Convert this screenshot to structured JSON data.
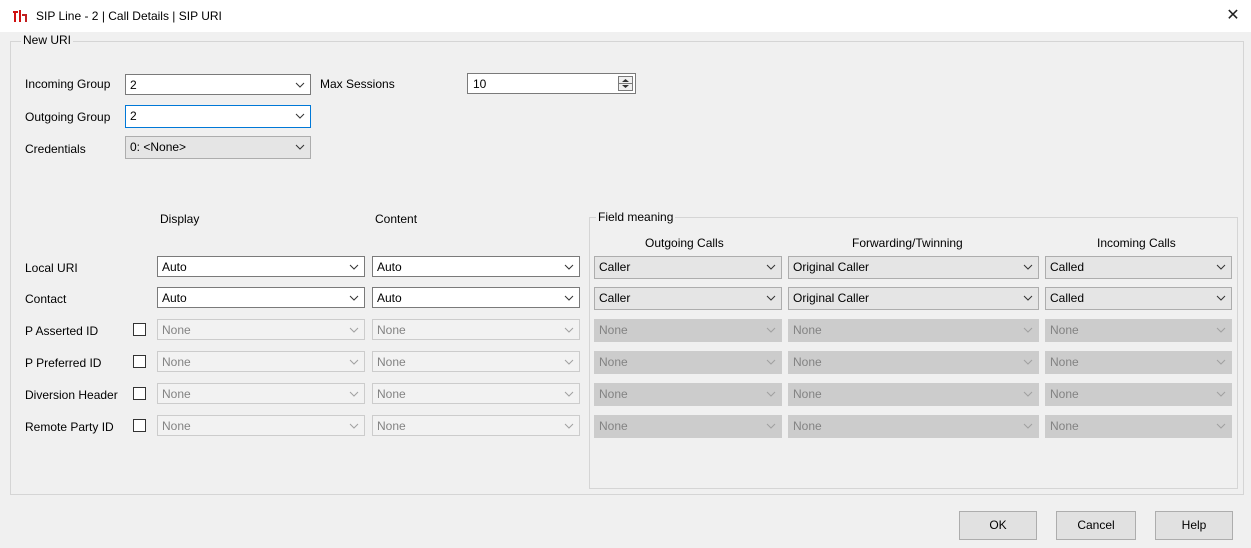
{
  "window": {
    "title": "SIP Line - 2 | Call Details | SIP URI",
    "close_glyph": "✕"
  },
  "new_uri": {
    "group_label": "New URI"
  },
  "incoming_group": {
    "label": "Incoming Group",
    "value": "2"
  },
  "outgoing_group": {
    "label": "Outgoing Group",
    "value": "2"
  },
  "credentials": {
    "label": "Credentials",
    "value": "0: <None>"
  },
  "max_sessions": {
    "label": "Max Sessions",
    "value": "10"
  },
  "headers": {
    "display": "Display",
    "content": "Content"
  },
  "field_meaning": {
    "label": "Field meaning",
    "outgoing": "Outgoing Calls",
    "forwarding": "Forwarding/Twinning",
    "incoming": "Incoming Calls"
  },
  "rows": [
    {
      "label": "Local URI",
      "display": "Auto",
      "content": "Auto",
      "outgoing": "Caller",
      "forwarding": "Original Caller",
      "incoming": "Called"
    },
    {
      "label": "Contact",
      "display": "Auto",
      "content": "Auto",
      "outgoing": "Caller",
      "forwarding": "Original Caller",
      "incoming": "Called"
    },
    {
      "label": "P Asserted ID",
      "display": "None",
      "content": "None",
      "outgoing": "None",
      "forwarding": "None",
      "incoming": "None",
      "checked": false
    },
    {
      "label": "P Preferred  ID",
      "display": "None",
      "content": "None",
      "outgoing": "None",
      "forwarding": "None",
      "incoming": "None",
      "checked": false
    },
    {
      "label": "Diversion Header",
      "display": "None",
      "content": "None",
      "outgoing": "None",
      "forwarding": "None",
      "incoming": "None",
      "checked": false
    },
    {
      "label": "Remote Party ID",
      "display": "None",
      "content": "None",
      "outgoing": "None",
      "forwarding": "None",
      "incoming": "None",
      "checked": false
    }
  ],
  "buttons": {
    "ok": "OK",
    "cancel": "Cancel",
    "help": "Help"
  },
  "icons": {
    "app": "app-logo-icon",
    "dropdown": "chevron-down-icon",
    "spinner": "spinner-icon",
    "close": "close-icon"
  },
  "colors": {
    "focus_border": "#0078d7",
    "window_bg": "#f0f0f0",
    "disabled_fill": "#cccccc"
  }
}
